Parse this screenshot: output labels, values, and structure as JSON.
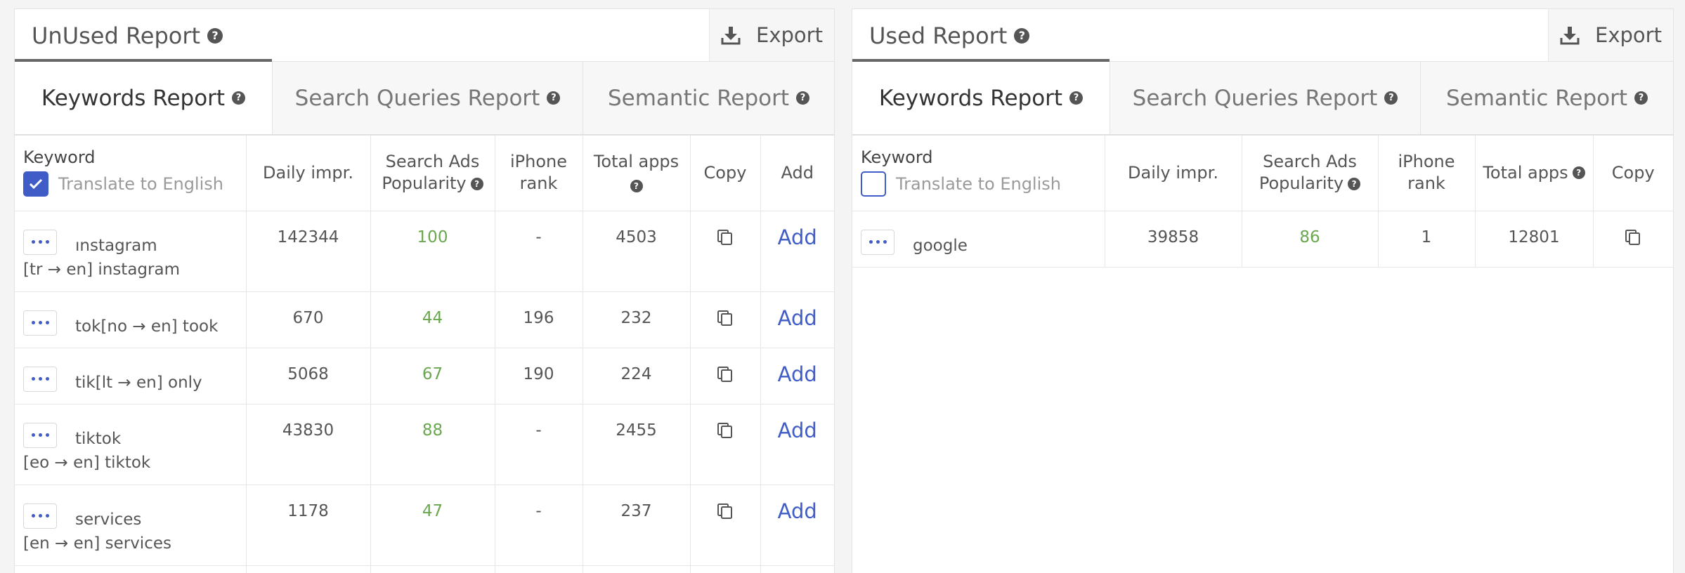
{
  "left": {
    "title": "UnUsed Report",
    "export_label": "Export",
    "tabs": [
      {
        "label": "Keywords Report",
        "active": true
      },
      {
        "label": "Search Queries Report",
        "active": false
      },
      {
        "label": "Semantic Report",
        "active": false
      }
    ],
    "columns": {
      "keyword": "Keyword",
      "translate": "Translate to English",
      "daily": "Daily impr.",
      "popularity_1": "Search Ads",
      "popularity_2": "Popularity",
      "rank_1": "iPhone",
      "rank_2": "rank",
      "total_1": "Total apps",
      "copy": "Copy",
      "add": "Add"
    },
    "translate_checked": true,
    "rows": [
      {
        "keyword": "ınstagram",
        "sub": "[tr → en] instagram",
        "daily": "142344",
        "popularity": "100",
        "rank": "-",
        "total": "4503",
        "add": "Add"
      },
      {
        "keyword": "tok[no → en] took",
        "sub": "",
        "daily": "670",
        "popularity": "44",
        "rank": "196",
        "total": "232",
        "add": "Add"
      },
      {
        "keyword": "tik[lt → en] only",
        "sub": "",
        "daily": "5068",
        "popularity": "67",
        "rank": "190",
        "total": "224",
        "add": "Add"
      },
      {
        "keyword": "tiktok",
        "sub": "[eo → en] tiktok",
        "daily": "43830",
        "popularity": "88",
        "rank": "-",
        "total": "2455",
        "add": "Add"
      },
      {
        "keyword": "services",
        "sub": "[en → en] services",
        "daily": "1178",
        "popularity": "47",
        "rank": "-",
        "total": "237",
        "add": "Add"
      }
    ]
  },
  "right": {
    "title": "Used Report",
    "export_label": "Export",
    "tabs": [
      {
        "label": "Keywords Report",
        "active": true
      },
      {
        "label": "Search Queries Report",
        "active": false
      },
      {
        "label": "Semantic Report",
        "active": false
      }
    ],
    "columns": {
      "keyword": "Keyword",
      "translate": "Translate to English",
      "daily": "Daily impr.",
      "popularity_1": "Search Ads",
      "popularity_2": "Popularity",
      "rank_1": "iPhone",
      "rank_2": "rank",
      "total": "Total apps",
      "copy": "Copy"
    },
    "translate_checked": false,
    "rows": [
      {
        "keyword": "google",
        "daily": "39858",
        "popularity": "86",
        "rank": "1",
        "total": "12801"
      }
    ]
  },
  "colors": {
    "accent": "#3f5cc7",
    "popularity_green": "#6aa84f"
  },
  "icons": {
    "help": "question-circle-icon",
    "export": "download-icon",
    "copy": "copy-icon",
    "menu": "more-dots-icon",
    "checkbox": "checkbox-icon"
  }
}
